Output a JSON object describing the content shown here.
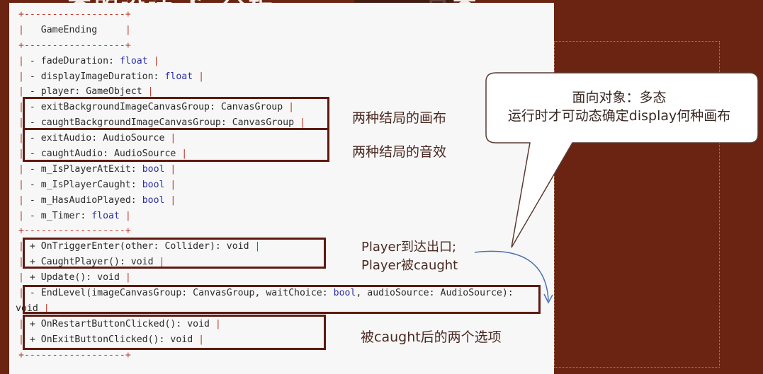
{
  "title_fragment": "类的设计 & 分析 · · · · · · 总类",
  "code_lines": [
    [
      {
        "t": "+------------------+",
        "c": "border"
      }
    ],
    [
      {
        "t": "|   ",
        "c": "pipe"
      },
      {
        "t": "GameEnding",
        "c": ""
      },
      {
        "t": "     |",
        "c": "pipe"
      }
    ],
    [
      {
        "t": "+------------------+",
        "c": "border"
      }
    ],
    [
      {
        "t": "| ",
        "c": "pipe"
      },
      {
        "t": "- fadeDuration: ",
        "c": ""
      },
      {
        "t": "float",
        "c": "kw"
      },
      {
        "t": " |",
        "c": "pipe"
      }
    ],
    [
      {
        "t": "| ",
        "c": "pipe"
      },
      {
        "t": "- displayImageDuration: ",
        "c": ""
      },
      {
        "t": "float",
        "c": "kw"
      },
      {
        "t": " |",
        "c": "pipe"
      }
    ],
    [
      {
        "t": "| ",
        "c": "pipe"
      },
      {
        "t": "- player: GameObject",
        "c": ""
      },
      {
        "t": " |",
        "c": "pipe"
      }
    ],
    [
      {
        "t": "| ",
        "c": "pipe"
      },
      {
        "t": "- exitBackgroundImageCanvasGroup: CanvasGroup",
        "c": ""
      },
      {
        "t": " |",
        "c": "pipe"
      }
    ],
    [
      {
        "t": "| ",
        "c": "pipe"
      },
      {
        "t": "- caughtBackgroundImageCanvasGroup: CanvasGroup",
        "c": ""
      },
      {
        "t": " |",
        "c": "pipe"
      }
    ],
    [
      {
        "t": "| ",
        "c": "pipe"
      },
      {
        "t": "- exitAudio: AudioSource",
        "c": ""
      },
      {
        "t": " |",
        "c": "pipe"
      }
    ],
    [
      {
        "t": "| ",
        "c": "pipe"
      },
      {
        "t": "- caughtAudio: AudioSource",
        "c": ""
      },
      {
        "t": " |",
        "c": "pipe"
      }
    ],
    [
      {
        "t": "| ",
        "c": "pipe"
      },
      {
        "t": "- m_IsPlayerAtExit: ",
        "c": ""
      },
      {
        "t": "bool",
        "c": "kw"
      },
      {
        "t": " |",
        "c": "pipe"
      }
    ],
    [
      {
        "t": "| ",
        "c": "pipe"
      },
      {
        "t": "- m_IsPlayerCaught: ",
        "c": ""
      },
      {
        "t": "bool",
        "c": "kw"
      },
      {
        "t": " |",
        "c": "pipe"
      }
    ],
    [
      {
        "t": "| ",
        "c": "pipe"
      },
      {
        "t": "- m_HasAudioPlayed: ",
        "c": ""
      },
      {
        "t": "bool",
        "c": "kw"
      },
      {
        "t": " |",
        "c": "pipe"
      }
    ],
    [
      {
        "t": "| ",
        "c": "pipe"
      },
      {
        "t": "- m_Timer: ",
        "c": ""
      },
      {
        "t": "float",
        "c": "kw"
      },
      {
        "t": " |",
        "c": "pipe"
      }
    ],
    [
      {
        "t": "+------------------+",
        "c": "border"
      }
    ],
    [
      {
        "t": "| ",
        "c": "pipe"
      },
      {
        "t": "+ OnTriggerEnter(other: Collider): void",
        "c": ""
      },
      {
        "t": " |",
        "c": "pipe"
      }
    ],
    [
      {
        "t": "| ",
        "c": "pipe"
      },
      {
        "t": "+ CaughtPlayer(): void",
        "c": ""
      },
      {
        "t": " |",
        "c": "pipe"
      }
    ],
    [
      {
        "t": "| ",
        "c": "pipe"
      },
      {
        "t": "+ Update(): void",
        "c": ""
      },
      {
        "t": " |",
        "c": "pipe"
      }
    ],
    [
      {
        "t": "| ",
        "c": "pipe"
      },
      {
        "t": "- EndLevel(imageCanvasGroup: CanvasGroup, waitChoice: ",
        "c": ""
      },
      {
        "t": "bool",
        "c": "kw"
      },
      {
        "t": ", audioSource: AudioSource):",
        "c": ""
      }
    ],
    [
      {
        "t": "void",
        "c": ""
      },
      {
        "t": " |",
        "c": "pipe"
      }
    ],
    [
      {
        "t": "| ",
        "c": "pipe"
      },
      {
        "t": "+ OnRestartButtonClicked(): void",
        "c": ""
      },
      {
        "t": " |",
        "c": "pipe"
      }
    ],
    [
      {
        "t": "| ",
        "c": "pipe"
      },
      {
        "t": "+ OnExitButtonClicked(): void",
        "c": ""
      },
      {
        "t": " |",
        "c": "pipe"
      }
    ],
    [
      {
        "t": "+------------------+",
        "c": "border"
      }
    ]
  ],
  "annotations": {
    "canvas": "两种结局的画布",
    "audio": "两种结局的音效",
    "trigger_line1": "Player到达出口;",
    "trigger_line2": "Player被caught",
    "options": "被caught后的两个选项"
  },
  "callout": {
    "line1": "面向对象：多态",
    "line2": "运行时才可动态确定display何种画布"
  }
}
